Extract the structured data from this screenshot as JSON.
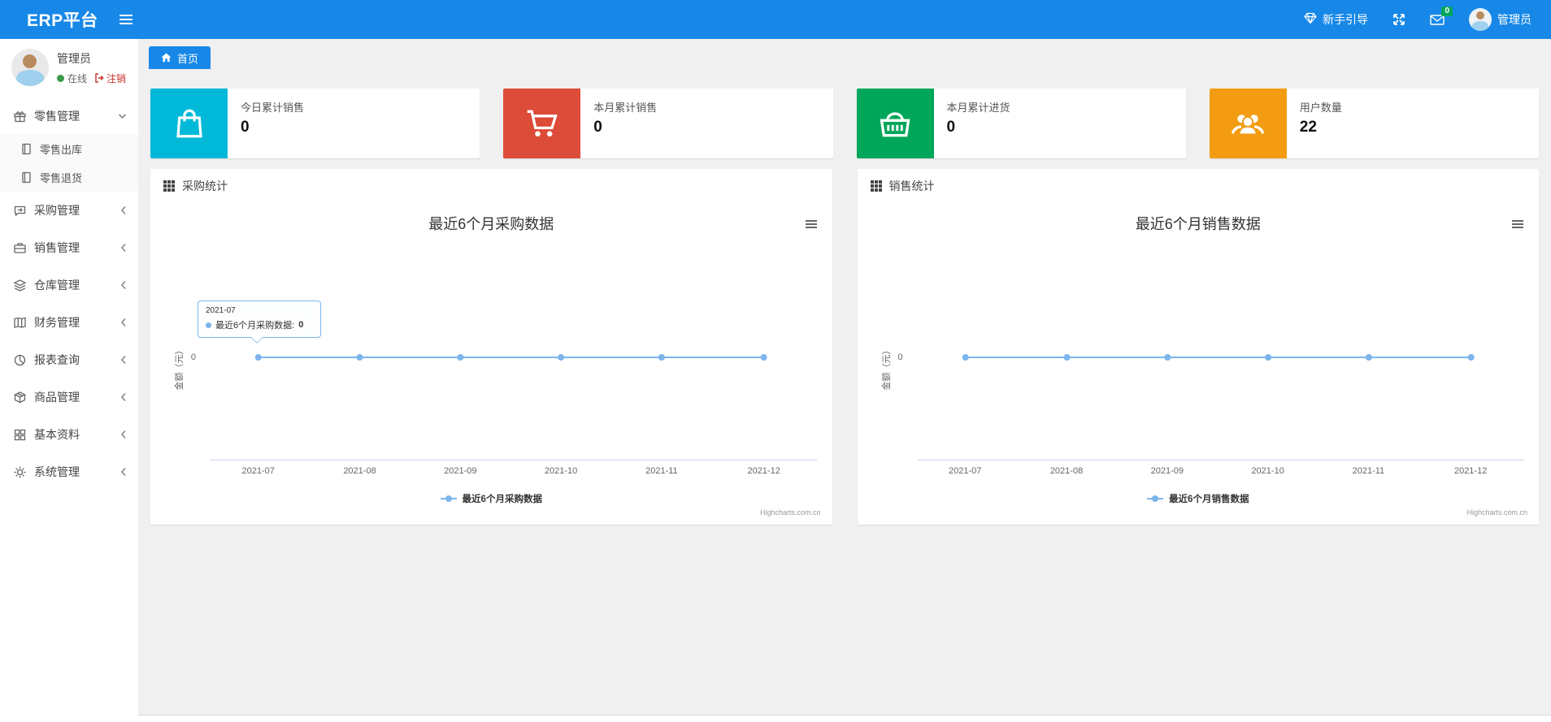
{
  "colors": {
    "navbar_bg": "#1788e8",
    "tab_bg": "#1788e8",
    "series_line": "#7cb5ec",
    "badge_bg": "#00a65a"
  },
  "navbar": {
    "brand": "ERP平台",
    "guide_label": "新手引导",
    "mail_badge": "0",
    "user_label": "管理员"
  },
  "sidebar": {
    "user": {
      "name": "管理员",
      "status": "在线",
      "logout": "注销"
    },
    "items": [
      {
        "label": "零售管理",
        "icon": "gift-icon",
        "expanded": true,
        "children": [
          {
            "label": "零售出库"
          },
          {
            "label": "零售退货"
          }
        ]
      },
      {
        "label": "采购管理",
        "icon": "purchase-icon"
      },
      {
        "label": "销售管理",
        "icon": "briefcase-icon"
      },
      {
        "label": "仓库管理",
        "icon": "layers-icon"
      },
      {
        "label": "财务管理",
        "icon": "ledger-icon"
      },
      {
        "label": "报表查询",
        "icon": "pie-chart-icon"
      },
      {
        "label": "商品管理",
        "icon": "box-icon"
      },
      {
        "label": "基本资料",
        "icon": "grid-icon"
      },
      {
        "label": "系统管理",
        "icon": "gear-icon"
      }
    ]
  },
  "tabs": [
    {
      "label": "首页"
    }
  ],
  "stat_cards": [
    {
      "label": "今日累计销售",
      "value": "0",
      "color": "#00b9d8",
      "icon": "shopping-bag-icon"
    },
    {
      "label": "本月累计销售",
      "value": "0",
      "color": "#dd4b39",
      "icon": "shopping-cart-icon"
    },
    {
      "label": "本月累计进货",
      "value": "0",
      "color": "#00a65a",
      "icon": "shopping-basket-icon"
    },
    {
      "label": "用户数量",
      "value": "22",
      "color": "#f39c12",
      "icon": "users-icon"
    }
  ],
  "panels": [
    {
      "header": "采购统计"
    },
    {
      "header": "销售统计"
    }
  ],
  "chart_data": [
    {
      "type": "line",
      "title": "最近6个月采购数据",
      "categories": [
        "2021-07",
        "2021-08",
        "2021-09",
        "2021-10",
        "2021-11",
        "2021-12"
      ],
      "series": [
        {
          "name": "最近6个月采购数据",
          "values": [
            0,
            0,
            0,
            0,
            0,
            0
          ],
          "color": "#7cb5ec"
        }
      ],
      "ylabel": "金额（元）",
      "yticks": [
        "0"
      ],
      "legend_position": "bottom",
      "grid": false,
      "credit": "Highcharts.com.cn",
      "tooltip": {
        "visible": true,
        "header": "2021-07",
        "label": "最近6个月采购数据:",
        "value": "0"
      }
    },
    {
      "type": "line",
      "title": "最近6个月销售数据",
      "categories": [
        "2021-07",
        "2021-08",
        "2021-09",
        "2021-10",
        "2021-11",
        "2021-12"
      ],
      "series": [
        {
          "name": "最近6个月销售数据",
          "values": [
            0,
            0,
            0,
            0,
            0,
            0
          ],
          "color": "#7cb5ec"
        }
      ],
      "ylabel": "金额（元）",
      "yticks": [
        "0"
      ],
      "legend_position": "bottom",
      "grid": false,
      "credit": "Highcharts.com.cn",
      "tooltip": {
        "visible": false
      }
    }
  ]
}
